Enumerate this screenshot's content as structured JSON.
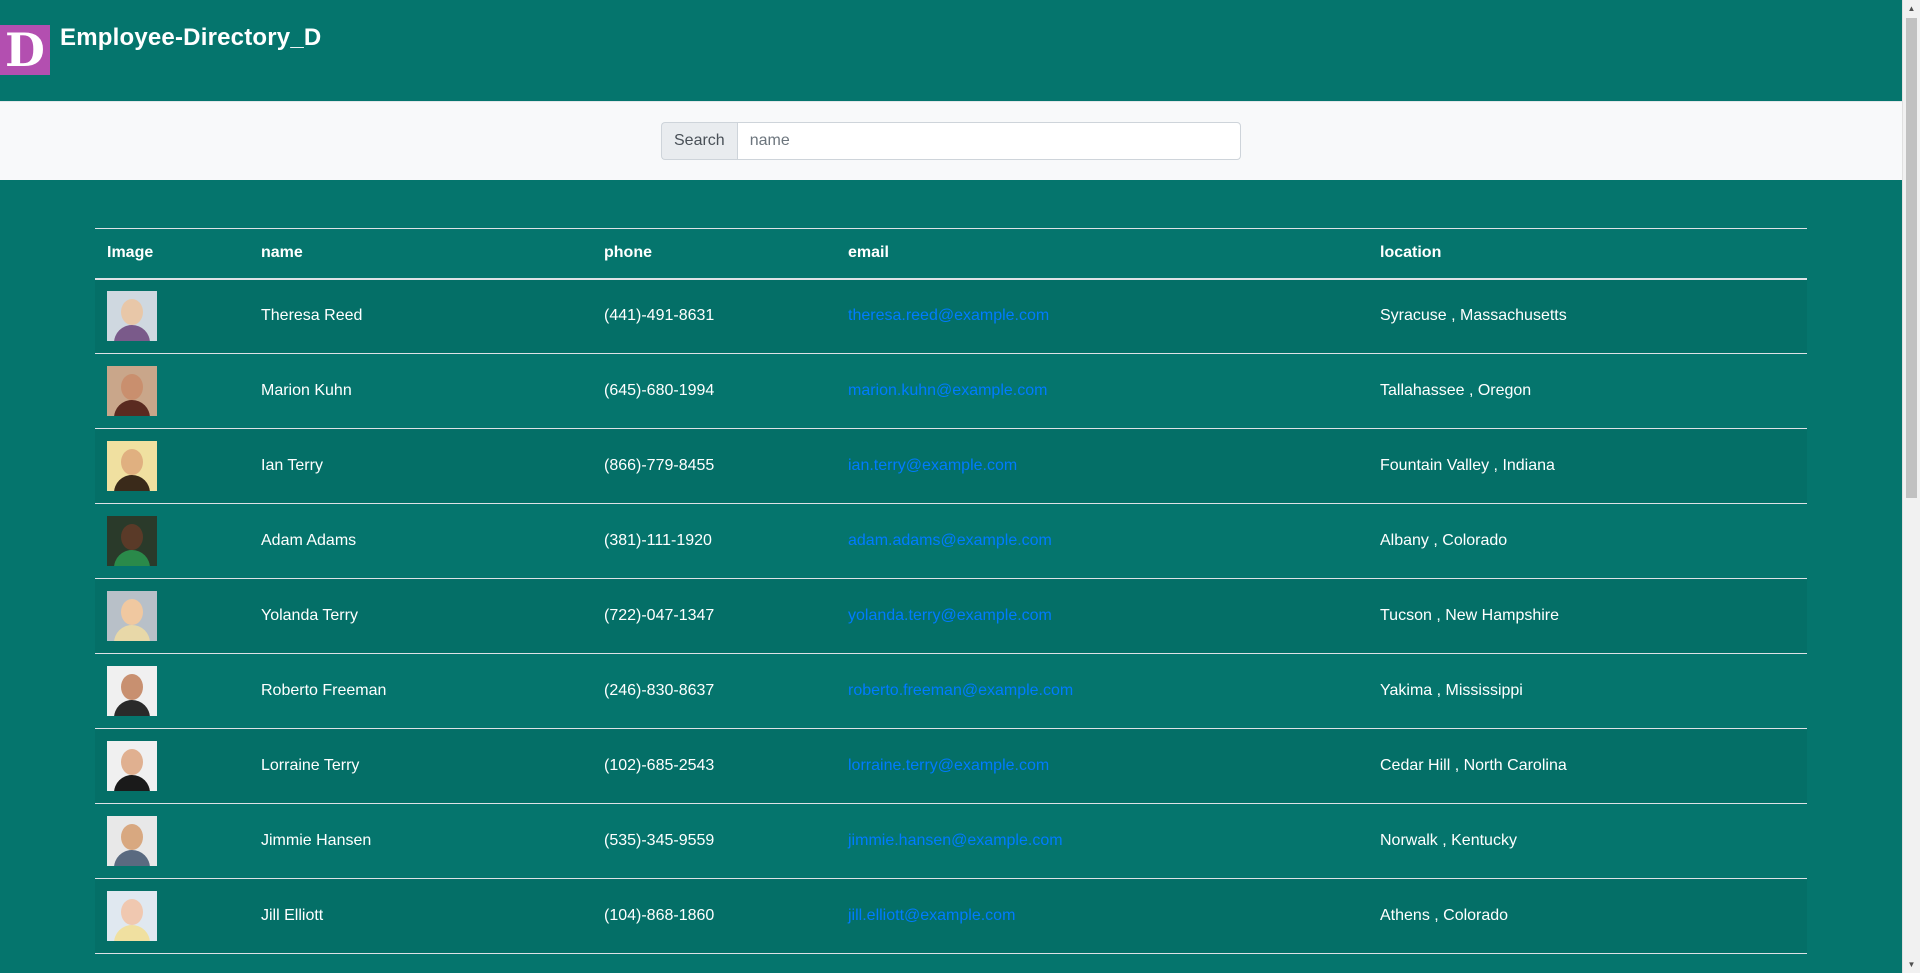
{
  "header": {
    "logo_letter": "D",
    "title": "Employee-Directory_D"
  },
  "search": {
    "label": "Search",
    "placeholder": "name",
    "value": ""
  },
  "table": {
    "columns": [
      "Image",
      "name",
      "phone",
      "email",
      "location"
    ],
    "rows": [
      {
        "name": "Theresa Reed",
        "phone": "(441)-491-8631",
        "email": "theresa.reed@example.com",
        "location": "Syracuse , Massachusetts"
      },
      {
        "name": "Marion Kuhn",
        "phone": "(645)-680-1994",
        "email": "marion.kuhn@example.com",
        "location": "Tallahassee , Oregon"
      },
      {
        "name": "Ian Terry",
        "phone": "(866)-779-8455",
        "email": "ian.terry@example.com",
        "location": "Fountain Valley , Indiana"
      },
      {
        "name": "Adam Adams",
        "phone": "(381)-111-1920",
        "email": "adam.adams@example.com",
        "location": "Albany , Colorado"
      },
      {
        "name": "Yolanda Terry",
        "phone": "(722)-047-1347",
        "email": "yolanda.terry@example.com",
        "location": "Tucson , New Hampshire"
      },
      {
        "name": "Roberto Freeman",
        "phone": "(246)-830-8637",
        "email": "roberto.freeman@example.com",
        "location": "Yakima , Mississippi"
      },
      {
        "name": "Lorraine Terry",
        "phone": "(102)-685-2543",
        "email": "lorraine.terry@example.com",
        "location": "Cedar Hill , North Carolina"
      },
      {
        "name": "Jimmie Hansen",
        "phone": "(535)-345-9559",
        "email": "jimmie.hansen@example.com",
        "location": "Norwalk , Kentucky"
      },
      {
        "name": "Jill Elliott",
        "phone": "(104)-868-1860",
        "email": "jill.elliott@example.com",
        "location": "Athens , Colorado"
      }
    ]
  },
  "colors": {
    "background": "#05756d",
    "logo": "#b34fb0",
    "link": "#007bff",
    "search_bar": "#f8f9fa"
  },
  "icons": {
    "scroll_up": "scroll-up-arrow-icon",
    "scroll_down": "scroll-down-arrow-icon"
  }
}
